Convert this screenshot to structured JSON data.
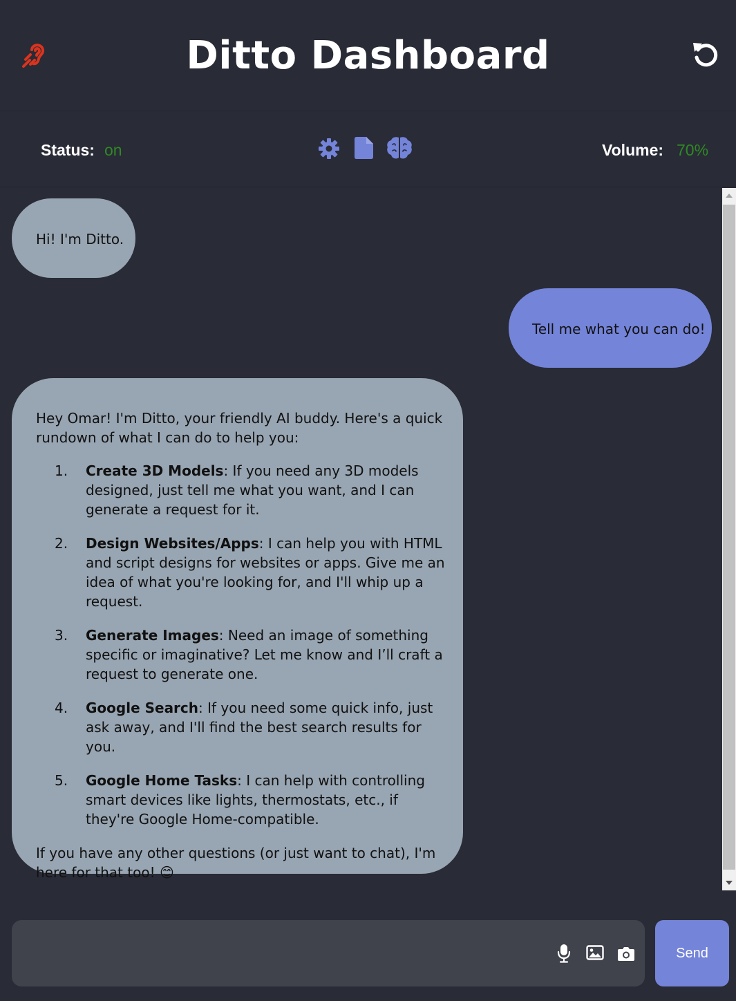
{
  "header": {
    "title": "Ditto Dashboard",
    "left_icon": "hearing-icon",
    "right_icon": "reset-icon"
  },
  "statusbar": {
    "status_label": "Status:",
    "status_value": "on",
    "volume_label": "Volume:",
    "volume_value": "70%",
    "icons": [
      "gear-icon",
      "file-icon",
      "brain-icon"
    ]
  },
  "colors": {
    "background": "#292b36",
    "accent": "#7484d9",
    "bot_bubble": "#98a5b2",
    "status_green": "#2f8a25",
    "header_icon": "#d9341e"
  },
  "messages": [
    {
      "role": "bot",
      "text": "Hi! I'm Ditto."
    },
    {
      "role": "user",
      "text": "Tell me what you can do!"
    },
    {
      "role": "bot",
      "intro": "Hey Omar! I'm Ditto, your friendly AI buddy. Here's a quick rundown of what I can do to help you:",
      "items": [
        {
          "num": "1.",
          "title": "Create 3D Models",
          "text": ": If you need any 3D models designed, just tell me what you want, and I can generate a request for it."
        },
        {
          "num": "2.",
          "title": "Design Websites/Apps",
          "text": ": I can help you with HTML and script designs for websites or apps. Give me an idea of what you're looking for, and I'll whip up a request."
        },
        {
          "num": "3.",
          "title": "Generate Images",
          "text": ": Need an image of something specific or imaginative? Let me know and I’ll craft a request to generate one."
        },
        {
          "num": "4.",
          "title": "Google Search",
          "text": ": If you need some quick info, just ask away, and I'll find the best search results for you."
        },
        {
          "num": "5.",
          "title": "Google Home Tasks",
          "text": ": I can help with controlling smart devices like lights, thermostats, etc., if they're Google Home-compatible."
        }
      ],
      "outro": "If you have any other questions (or just want to chat), I'm here for that too! 😊"
    }
  ],
  "input": {
    "value": "",
    "placeholder": "",
    "icons": [
      "microphone-icon",
      "image-icon",
      "camera-icon"
    ],
    "send_label": "Send"
  }
}
